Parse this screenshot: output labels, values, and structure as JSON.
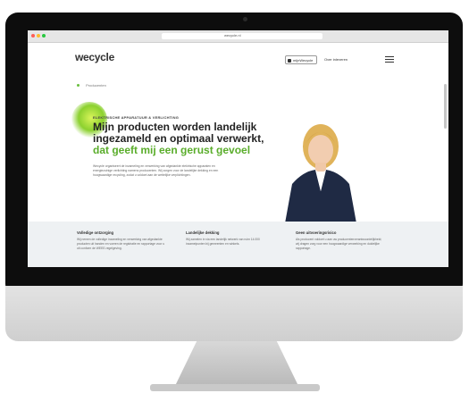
{
  "browser": {
    "url": "wecycle.nl"
  },
  "header": {
    "logo": "wecycle",
    "button_label": "mijnWecycle",
    "link_label": "Over inleveren"
  },
  "breadcrumb": {
    "current": "Producenten"
  },
  "hero": {
    "eyebrow": "ELEKTRISCHE APPARATUUR & VERLICHTING",
    "headline_line1": "Mijn producten worden landelijk",
    "headline_line2": "ingezameld en optimaal verwerkt,",
    "headline_green": "dat geeft mij een gerust gevoel",
    "intro": "Wecycle organiseert de inzameling en verwerking van afgedankte elektrische apparaten en energiezuinige verlichting namens producenten. Wij zorgen voor de landelijke dekking en een hoogwaardige recycling, zodat u voldoet aan de wettelijke verplichtingen."
  },
  "features": [
    {
      "title": "Volledige ontzorging",
      "text": "Wij nemen de volledige inzameling en verwerking van afgedankte producten uit handen en voeren de registratie en rapportage voor u uit conform de WEEE-regelgeving."
    },
    {
      "title": "Landelijke dekking",
      "text": "Wij zamelen in via een landelijk netwerk van ruim 14.000 inzamelpunten bij gemeenten en winkels."
    },
    {
      "title": "Geen uitvoeringsrisico",
      "text": "Als producent voldoet u aan uw producentenverantwoordelijkheid; wij dragen zorg voor een hoogwaardige verwerking en duidelijke rapportage."
    }
  ],
  "colors": {
    "brand_green": "#5aad2b",
    "blob_yellow": "#d9f45a",
    "navy": "#1f2a44"
  }
}
